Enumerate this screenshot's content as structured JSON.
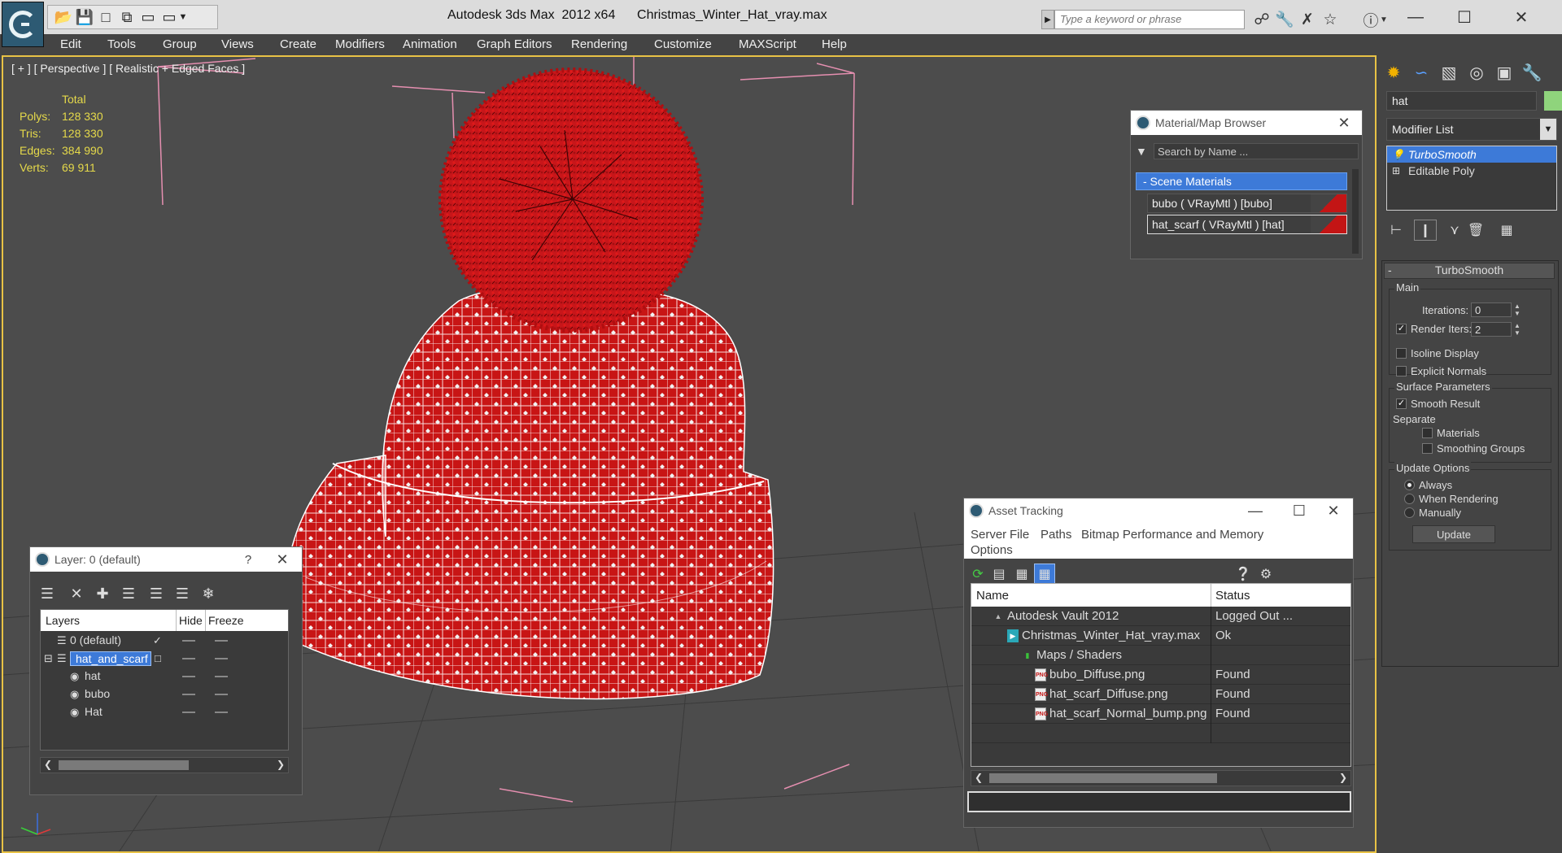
{
  "window": {
    "title": "Autodesk 3ds Max  2012 x64      Christmas_Winter_Hat_vray.max",
    "search_placeholder": "Type a keyword or phrase"
  },
  "menu": [
    "Edit",
    "Tools",
    "Group",
    "Views",
    "Create",
    "Modifiers",
    "Animation",
    "Graph Editors",
    "Rendering",
    "Customize",
    "MAXScript",
    "Help"
  ],
  "viewport": {
    "label": "[ + ] [ Perspective ] [ Realistic + Edged Faces ]",
    "stats": {
      "header": "Total",
      "rows": [
        {
          "key": "Polys:",
          "value": "128 330"
        },
        {
          "key": "Tris:",
          "value": "128 330"
        },
        {
          "key": "Edges:",
          "value": "384 990"
        },
        {
          "key": "Verts:",
          "value": "69 911"
        }
      ]
    },
    "colors": {
      "hat_red": "#c81515",
      "wire": "#ffffff",
      "bg": "#4c4c4c",
      "active_border": "#e8c245"
    }
  },
  "command_panel": {
    "object_name": "hat",
    "object_color": "#8fd47c",
    "modifier_list_label": "Modifier List",
    "stack": [
      {
        "label": "TurboSmooth",
        "selected": true
      },
      {
        "label": "Editable Poly",
        "selected": false
      }
    ],
    "turbosmooth": {
      "title": "TurboSmooth",
      "main_label": "Main",
      "iterations_label": "Iterations:",
      "iterations_value": "0",
      "render_iters_label": "Render Iters:",
      "render_iters_value": "2",
      "render_iters_checked": true,
      "isoline_label": "Isoline Display",
      "explicit_normals_label": "Explicit Normals",
      "surface_params_label": "Surface Parameters",
      "smooth_result_label": "Smooth Result",
      "separate_label": "Separate",
      "materials_label": "Materials",
      "smoothing_groups_label": "Smoothing Groups",
      "update_options_label": "Update Options",
      "always_label": "Always",
      "when_rendering_label": "When Rendering",
      "manually_label": "Manually",
      "update_button": "Update"
    }
  },
  "material_browser": {
    "title": "Material/Map Browser",
    "search_placeholder": "Search by Name ...",
    "group_label": "- Scene Materials",
    "items": [
      {
        "label": "bubo  ( VRayMtl )  [bubo]"
      },
      {
        "label": "hat_scarf  ( VRayMtl )  [hat]"
      }
    ]
  },
  "asset_tracking": {
    "title": "Asset Tracking",
    "menu": [
      "Server",
      "File",
      "Paths",
      "Bitmap Performance and Memory"
    ],
    "menu2": "Options",
    "columns": [
      "Name",
      "Status"
    ],
    "rows": [
      {
        "name": "Autodesk Vault 2012",
        "status": "Logged Out ...",
        "indent": 1,
        "icon": "vault-icon"
      },
      {
        "name": "Christmas_Winter_Hat_vray.max",
        "status": "Ok",
        "indent": 2,
        "icon": "max-file-icon"
      },
      {
        "name": "Maps / Shaders",
        "status": "",
        "indent": 3,
        "icon": "maps-folder-icon"
      },
      {
        "name": "bubo_Diffuse.png",
        "status": "Found",
        "indent": 4,
        "icon": "png-file-icon"
      },
      {
        "name": "hat_scarf_Diffuse.png",
        "status": "Found",
        "indent": 4,
        "icon": "png-file-icon"
      },
      {
        "name": "hat_scarf_Normal_bump.png",
        "status": "Found",
        "indent": 4,
        "icon": "png-file-icon"
      }
    ]
  },
  "layer_window": {
    "title": "Layer: 0 (default)",
    "help": "?",
    "columns": [
      "Layers",
      "Hide",
      "Freeze"
    ],
    "rows": [
      {
        "name": "0 (default)",
        "level": 0,
        "selected": false,
        "current": true
      },
      {
        "name": "hat_and_scarf",
        "level": 0,
        "selected": true,
        "current": false
      },
      {
        "name": "hat",
        "level": 1,
        "selected": false,
        "current": false
      },
      {
        "name": "bubo",
        "level": 1,
        "selected": false,
        "current": false
      },
      {
        "name": "Hat",
        "level": 1,
        "selected": false,
        "current": false
      }
    ]
  }
}
